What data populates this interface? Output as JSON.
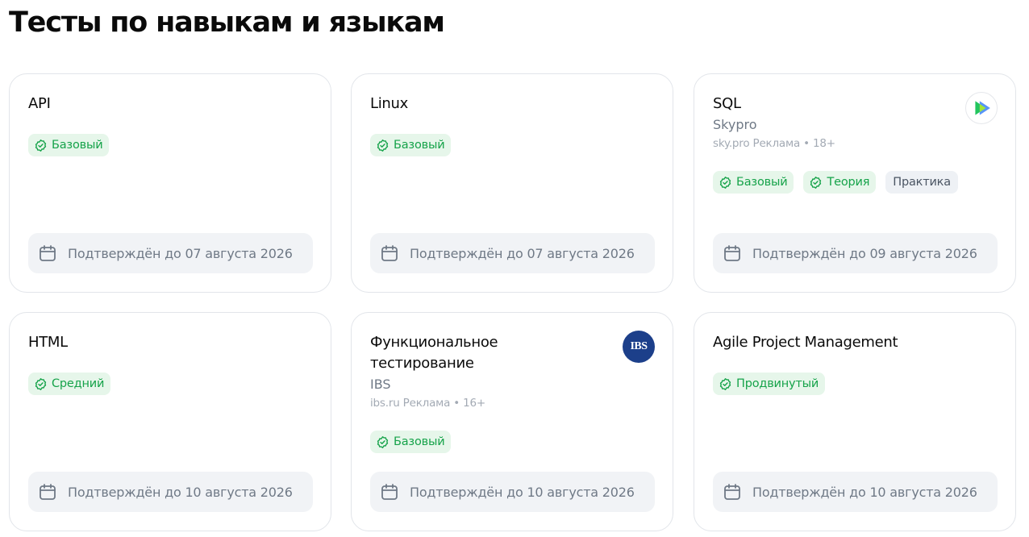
{
  "page_title": "Тесты по навыкам и языкам",
  "colors": {
    "badge_green": "#16a34a",
    "badge_green_bg": "#e6f6ea",
    "muted": "#6f7986",
    "ibs_logo": "#1c3f8a"
  },
  "cards": [
    {
      "title": "API",
      "tags": [
        {
          "label": "Базовый",
          "style": "green",
          "icon": "verified-badge-icon"
        }
      ],
      "validity": "Подтверждён до 07 августа 2026"
    },
    {
      "title": "Linux",
      "tags": [
        {
          "label": "Базовый",
          "style": "green",
          "icon": "verified-badge-icon"
        }
      ],
      "validity": "Подтверждён до 07 августа 2026"
    },
    {
      "title": "SQL",
      "subtitle": "Skypro",
      "ad_line": "sky.pro Реклама • 18+",
      "logo": "skypro-logo",
      "tags": [
        {
          "label": "Базовый",
          "style": "green",
          "icon": "verified-badge-icon"
        },
        {
          "label": "Теория",
          "style": "green",
          "icon": "verified-badge-icon"
        },
        {
          "label": "Практика",
          "style": "gray"
        }
      ],
      "validity": "Подтверждён до 09 августа 2026"
    },
    {
      "title": "HTML",
      "tags": [
        {
          "label": "Средний",
          "style": "green",
          "icon": "verified-badge-icon"
        }
      ],
      "validity": "Подтверждён до 10 августа 2026"
    },
    {
      "title": "Функциональное тестирование",
      "subtitle": "IBS",
      "ad_line": "ibs.ru Реклама • 16+",
      "logo": "ibs-logo",
      "logo_text": "IBS",
      "tags": [
        {
          "label": "Базовый",
          "style": "green",
          "icon": "verified-badge-icon"
        }
      ],
      "validity": "Подтверждён до 10 августа 2026"
    },
    {
      "title": "Agile Project Management",
      "tags": [
        {
          "label": "Продвинутый",
          "style": "green",
          "icon": "verified-badge-icon"
        }
      ],
      "validity": "Подтверждён до 10 августа 2026"
    }
  ]
}
